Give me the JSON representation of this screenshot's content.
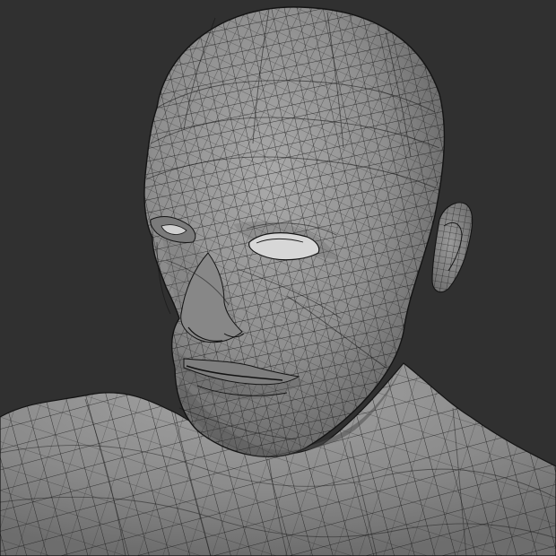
{
  "viewport": {
    "background_color": "#303030",
    "subject": "wireframe-head-bust",
    "shading": "solid-gray",
    "surface_color": "#8c8c8c",
    "wire_color": "#151515",
    "eye_white_color": "#d7d7d7"
  }
}
